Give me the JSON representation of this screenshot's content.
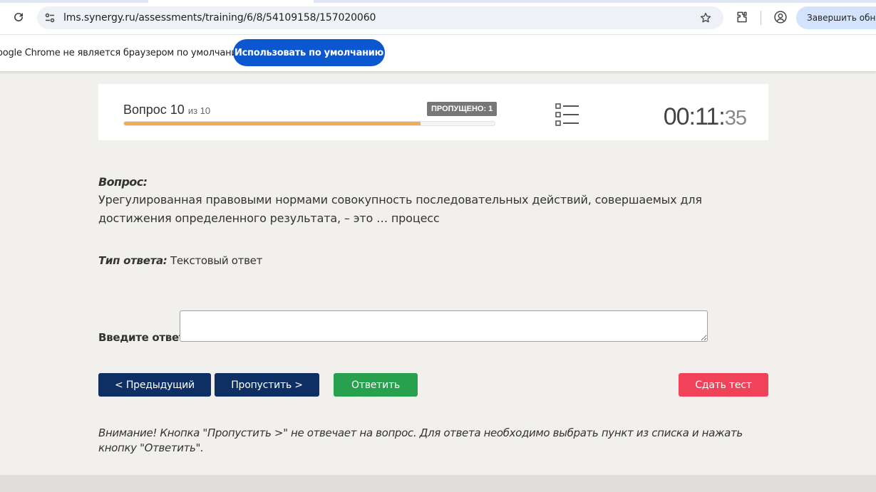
{
  "browser": {
    "url": "lms.synergy.ru/assessments/training/6/8/54109158/157020060",
    "update_chip_label": "Завершить обновление"
  },
  "infobar": {
    "message": "oogle Chrome не является браузером по умолчанию.",
    "button_label": "Использовать по умолчанию"
  },
  "test_header": {
    "question_label": "Вопрос 10",
    "question_total": "из 10",
    "skipped_badge": "ПРОПУЩЕНО: 1",
    "progress_fraction": 0.8,
    "timer_main": "00:11:",
    "timer_seconds": "35"
  },
  "question": {
    "label": "Вопрос:",
    "text": "Урегулированная правовыми нормами совокупность последовательных действий, совершаемых для достижения определенного результата, – это … процесс",
    "answer_type_label": "Тип ответа:",
    "answer_type_value": "Текстовый ответ",
    "answer_prompt": "Введите ответ:",
    "answer_value": ""
  },
  "buttons": {
    "prev": "< Предыдущий",
    "skip": "Пропустить >",
    "answer": "Ответить",
    "submit": "Сдать тест"
  },
  "warning": "Внимание! Кнопка \"Пропустить >\" не отвечает на вопрос. Для ответа необходимо выбрать пункт из списка и нажать кнопку \"Ответить\".",
  "colors": {
    "primary_navy": "#0e2f63",
    "success_green": "#28a14f",
    "danger_red": "#f0435a",
    "progress_orange": "#f0ad4e",
    "chrome_blue": "#0b57d0"
  }
}
